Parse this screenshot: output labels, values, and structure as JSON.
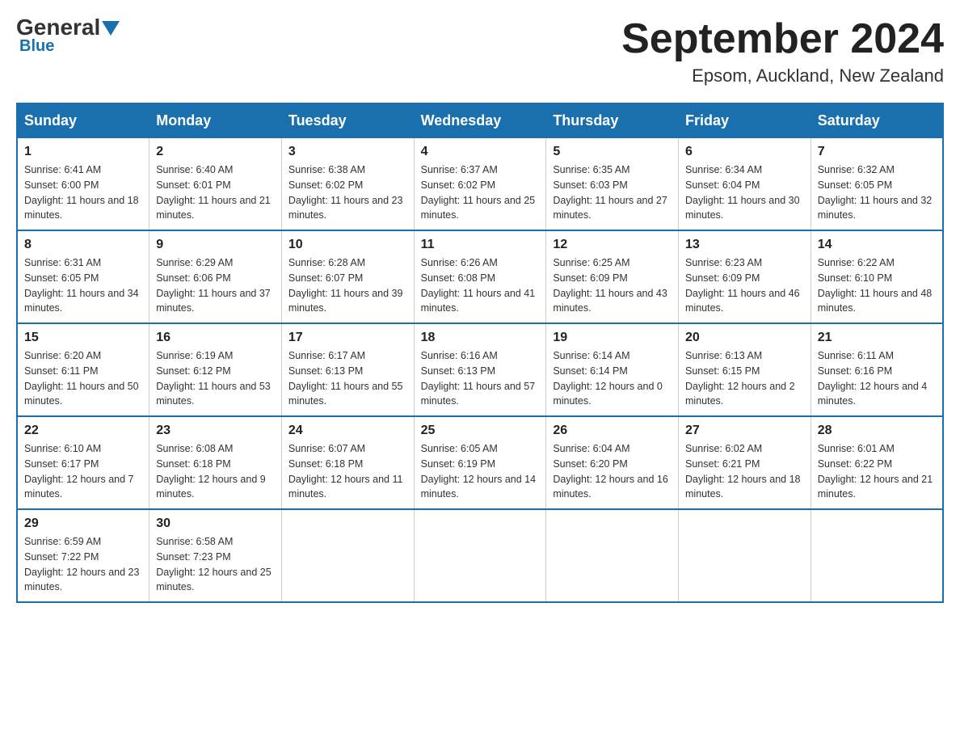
{
  "header": {
    "logo_text1": "General",
    "logo_text2": "Blue",
    "month_title": "September 2024",
    "location": "Epsom, Auckland, New Zealand"
  },
  "days_of_week": [
    "Sunday",
    "Monday",
    "Tuesday",
    "Wednesday",
    "Thursday",
    "Friday",
    "Saturday"
  ],
  "weeks": [
    [
      {
        "day": "1",
        "sunrise": "Sunrise: 6:41 AM",
        "sunset": "Sunset: 6:00 PM",
        "daylight": "Daylight: 11 hours and 18 minutes."
      },
      {
        "day": "2",
        "sunrise": "Sunrise: 6:40 AM",
        "sunset": "Sunset: 6:01 PM",
        "daylight": "Daylight: 11 hours and 21 minutes."
      },
      {
        "day": "3",
        "sunrise": "Sunrise: 6:38 AM",
        "sunset": "Sunset: 6:02 PM",
        "daylight": "Daylight: 11 hours and 23 minutes."
      },
      {
        "day": "4",
        "sunrise": "Sunrise: 6:37 AM",
        "sunset": "Sunset: 6:02 PM",
        "daylight": "Daylight: 11 hours and 25 minutes."
      },
      {
        "day": "5",
        "sunrise": "Sunrise: 6:35 AM",
        "sunset": "Sunset: 6:03 PM",
        "daylight": "Daylight: 11 hours and 27 minutes."
      },
      {
        "day": "6",
        "sunrise": "Sunrise: 6:34 AM",
        "sunset": "Sunset: 6:04 PM",
        "daylight": "Daylight: 11 hours and 30 minutes."
      },
      {
        "day": "7",
        "sunrise": "Sunrise: 6:32 AM",
        "sunset": "Sunset: 6:05 PM",
        "daylight": "Daylight: 11 hours and 32 minutes."
      }
    ],
    [
      {
        "day": "8",
        "sunrise": "Sunrise: 6:31 AM",
        "sunset": "Sunset: 6:05 PM",
        "daylight": "Daylight: 11 hours and 34 minutes."
      },
      {
        "day": "9",
        "sunrise": "Sunrise: 6:29 AM",
        "sunset": "Sunset: 6:06 PM",
        "daylight": "Daylight: 11 hours and 37 minutes."
      },
      {
        "day": "10",
        "sunrise": "Sunrise: 6:28 AM",
        "sunset": "Sunset: 6:07 PM",
        "daylight": "Daylight: 11 hours and 39 minutes."
      },
      {
        "day": "11",
        "sunrise": "Sunrise: 6:26 AM",
        "sunset": "Sunset: 6:08 PM",
        "daylight": "Daylight: 11 hours and 41 minutes."
      },
      {
        "day": "12",
        "sunrise": "Sunrise: 6:25 AM",
        "sunset": "Sunset: 6:09 PM",
        "daylight": "Daylight: 11 hours and 43 minutes."
      },
      {
        "day": "13",
        "sunrise": "Sunrise: 6:23 AM",
        "sunset": "Sunset: 6:09 PM",
        "daylight": "Daylight: 11 hours and 46 minutes."
      },
      {
        "day": "14",
        "sunrise": "Sunrise: 6:22 AM",
        "sunset": "Sunset: 6:10 PM",
        "daylight": "Daylight: 11 hours and 48 minutes."
      }
    ],
    [
      {
        "day": "15",
        "sunrise": "Sunrise: 6:20 AM",
        "sunset": "Sunset: 6:11 PM",
        "daylight": "Daylight: 11 hours and 50 minutes."
      },
      {
        "day": "16",
        "sunrise": "Sunrise: 6:19 AM",
        "sunset": "Sunset: 6:12 PM",
        "daylight": "Daylight: 11 hours and 53 minutes."
      },
      {
        "day": "17",
        "sunrise": "Sunrise: 6:17 AM",
        "sunset": "Sunset: 6:13 PM",
        "daylight": "Daylight: 11 hours and 55 minutes."
      },
      {
        "day": "18",
        "sunrise": "Sunrise: 6:16 AM",
        "sunset": "Sunset: 6:13 PM",
        "daylight": "Daylight: 11 hours and 57 minutes."
      },
      {
        "day": "19",
        "sunrise": "Sunrise: 6:14 AM",
        "sunset": "Sunset: 6:14 PM",
        "daylight": "Daylight: 12 hours and 0 minutes."
      },
      {
        "day": "20",
        "sunrise": "Sunrise: 6:13 AM",
        "sunset": "Sunset: 6:15 PM",
        "daylight": "Daylight: 12 hours and 2 minutes."
      },
      {
        "day": "21",
        "sunrise": "Sunrise: 6:11 AM",
        "sunset": "Sunset: 6:16 PM",
        "daylight": "Daylight: 12 hours and 4 minutes."
      }
    ],
    [
      {
        "day": "22",
        "sunrise": "Sunrise: 6:10 AM",
        "sunset": "Sunset: 6:17 PM",
        "daylight": "Daylight: 12 hours and 7 minutes."
      },
      {
        "day": "23",
        "sunrise": "Sunrise: 6:08 AM",
        "sunset": "Sunset: 6:18 PM",
        "daylight": "Daylight: 12 hours and 9 minutes."
      },
      {
        "day": "24",
        "sunrise": "Sunrise: 6:07 AM",
        "sunset": "Sunset: 6:18 PM",
        "daylight": "Daylight: 12 hours and 11 minutes."
      },
      {
        "day": "25",
        "sunrise": "Sunrise: 6:05 AM",
        "sunset": "Sunset: 6:19 PM",
        "daylight": "Daylight: 12 hours and 14 minutes."
      },
      {
        "day": "26",
        "sunrise": "Sunrise: 6:04 AM",
        "sunset": "Sunset: 6:20 PM",
        "daylight": "Daylight: 12 hours and 16 minutes."
      },
      {
        "day": "27",
        "sunrise": "Sunrise: 6:02 AM",
        "sunset": "Sunset: 6:21 PM",
        "daylight": "Daylight: 12 hours and 18 minutes."
      },
      {
        "day": "28",
        "sunrise": "Sunrise: 6:01 AM",
        "sunset": "Sunset: 6:22 PM",
        "daylight": "Daylight: 12 hours and 21 minutes."
      }
    ],
    [
      {
        "day": "29",
        "sunrise": "Sunrise: 6:59 AM",
        "sunset": "Sunset: 7:22 PM",
        "daylight": "Daylight: 12 hours and 23 minutes."
      },
      {
        "day": "30",
        "sunrise": "Sunrise: 6:58 AM",
        "sunset": "Sunset: 7:23 PM",
        "daylight": "Daylight: 12 hours and 25 minutes."
      },
      null,
      null,
      null,
      null,
      null
    ]
  ]
}
